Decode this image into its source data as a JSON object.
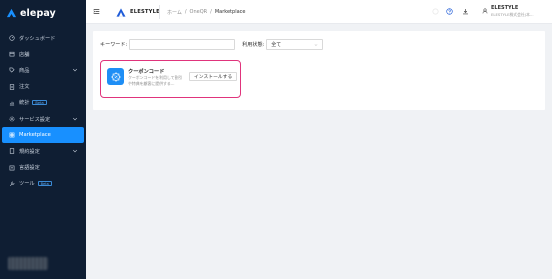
{
  "brand": {
    "name": "elepay"
  },
  "sidebar": {
    "items": [
      {
        "label": "ダッシュボード",
        "icon": "dashboard-icon",
        "has_chevron": false,
        "badge": ""
      },
      {
        "label": "店舗",
        "icon": "store-icon",
        "has_chevron": false,
        "badge": ""
      },
      {
        "label": "商品",
        "icon": "tag-icon",
        "has_chevron": true,
        "badge": ""
      },
      {
        "label": "注文",
        "icon": "order-icon",
        "has_chevron": false,
        "badge": ""
      },
      {
        "label": "統計",
        "icon": "chart-icon",
        "has_chevron": false,
        "badge": "Beta"
      },
      {
        "label": "サービス設定",
        "icon": "gear-icon",
        "has_chevron": true,
        "badge": ""
      },
      {
        "label": "Marketplace",
        "icon": "grid-icon",
        "has_chevron": false,
        "badge": "",
        "active": true
      },
      {
        "label": "規約設定",
        "icon": "doc-icon",
        "has_chevron": true,
        "badge": ""
      },
      {
        "label": "言語設定",
        "icon": "globe-icon",
        "has_chevron": false,
        "badge": ""
      },
      {
        "label": "ツール",
        "icon": "wrench-icon",
        "has_chevron": false,
        "badge": "Beta"
      }
    ]
  },
  "header": {
    "org_name": "ELESTYLE",
    "breadcrumb": [
      "ホーム",
      "/",
      "OneQR",
      "/",
      "Marketplace"
    ],
    "user": {
      "name": "ELESTYLE",
      "org": "ELESTYLE株式会社(本..."
    }
  },
  "filters": {
    "keyword_label": "キーワード:",
    "keyword_value": "",
    "keyword_placeholder": "",
    "status_label": "利用状態:",
    "status_value": "全て"
  },
  "apps": [
    {
      "title": "クーポンコード",
      "description": "クーポンコードを利用して割引や特典を顧客に提供する...",
      "install_label": "インストールする"
    }
  ],
  "colors": {
    "sidebar_bg": "#0f1e33",
    "accent": "#1890ff",
    "highlight": "#e0347c"
  }
}
